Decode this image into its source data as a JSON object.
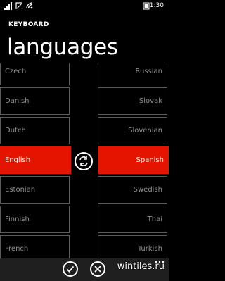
{
  "status": {
    "time": "1:30"
  },
  "header": {
    "app_name": "KEYBOARD",
    "page_title": "languages"
  },
  "source_languages": [
    "Czech",
    "Danish",
    "Dutch",
    "English",
    "Estonian",
    "Finnish",
    "French"
  ],
  "target_languages": [
    "Russian",
    "Slovak",
    "Slovenian",
    "Spanish",
    "Swedish",
    "Thai",
    "Turkish"
  ],
  "selected": {
    "source": "English",
    "target": "Spanish"
  },
  "app_bar": {
    "buttons": [
      "check-icon",
      "close-icon"
    ],
    "more": "more-dots-icon"
  },
  "watermark": "wintiles.ru",
  "colors": {
    "accent": "#e51400",
    "background": "#000000",
    "tile_border": "#5a5a5a",
    "tile_text": "#8f8f8f",
    "app_bar": "#1f1f1f"
  }
}
